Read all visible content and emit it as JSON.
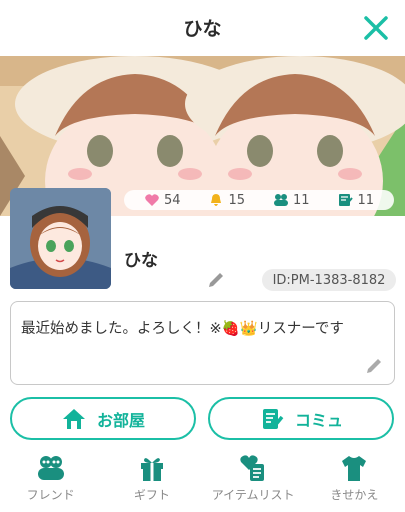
{
  "header": {
    "title": "ひな"
  },
  "stats": [
    {
      "icon": "heart-icon",
      "value": "54"
    },
    {
      "icon": "bell-icon",
      "value": "15"
    },
    {
      "icon": "friends-icon",
      "value": "11"
    },
    {
      "icon": "notebook-icon",
      "value": "11"
    }
  ],
  "profile": {
    "name": "ひな",
    "id": "ID:PM-1383-8182",
    "bio": "最近始めました。よろしく！※🍓👑リスナーです"
  },
  "actions": {
    "room_label": "お部屋",
    "community_label": "コミュ"
  },
  "nav": [
    {
      "label": "フレンド"
    },
    {
      "label": "ギフト"
    },
    {
      "label": "アイテムリスト"
    },
    {
      "label": "きせかえ"
    }
  ],
  "colors": {
    "accent": "#1bbfa6",
    "pink": "#f07aa8",
    "gold": "#f2b21b",
    "teal": "#1a8f7f"
  }
}
